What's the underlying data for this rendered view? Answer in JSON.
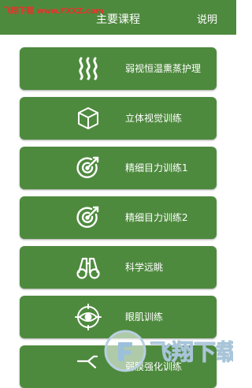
{
  "header": {
    "watermark": "飞翔下载 www.FXXZ.com",
    "title": "主要课程",
    "action": "说明"
  },
  "courses": [
    {
      "label": "弱视恒温熏蒸护理",
      "icon": "steam-icon"
    },
    {
      "label": "立体视觉训练",
      "icon": "cube-icon"
    },
    {
      "label": "精细目力训练1",
      "icon": "target-arrow-icon"
    },
    {
      "label": "精细目力训练2",
      "icon": "target-arrow-icon"
    },
    {
      "label": "科学远眺",
      "icon": "binoculars-icon"
    },
    {
      "label": "眼肌训练",
      "icon": "eye-target-icon"
    },
    {
      "label": "弱膜强化训练",
      "icon": "branch-icon"
    }
  ],
  "bottom_logo": {
    "text": "飞翔下载"
  },
  "colors": {
    "primary": "#4e8a3e",
    "watermark_red": "#e8322a"
  }
}
